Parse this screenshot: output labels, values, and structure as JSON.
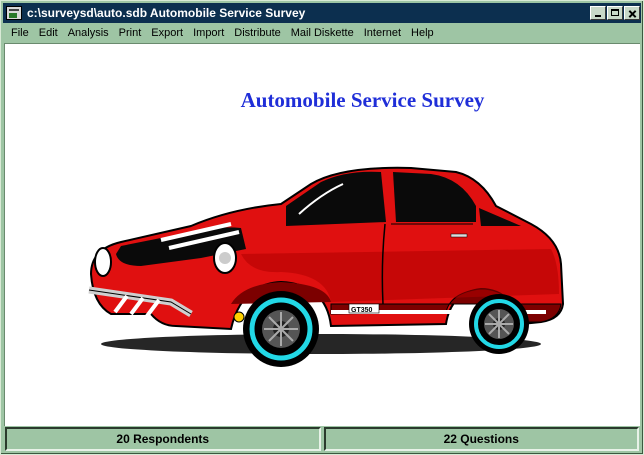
{
  "window": {
    "title": "c:\\surveysd\\auto.sdb Automobile Service Survey"
  },
  "menu": [
    {
      "label": "File"
    },
    {
      "label": "Edit"
    },
    {
      "label": "Analysis"
    },
    {
      "label": "Print"
    },
    {
      "label": "Export"
    },
    {
      "label": "Import"
    },
    {
      "label": "Distribute"
    },
    {
      "label": "Mail Diskette"
    },
    {
      "label": "Internet"
    },
    {
      "label": "Help"
    }
  ],
  "main": {
    "heading": "Automobile Service Survey",
    "image": {
      "icon": "red-sports-car-illustration",
      "badge_text": "GT350"
    }
  },
  "status": {
    "respondents": "20 Respondents",
    "questions": "22 Questions"
  },
  "colors": {
    "titlebar": "#0c2f4f",
    "chrome": "#9ec5a4",
    "heading": "#1f2ed8",
    "car_body": "#e01010",
    "car_dark": "#8a0000",
    "wheel_rim": "#22d8e6"
  }
}
